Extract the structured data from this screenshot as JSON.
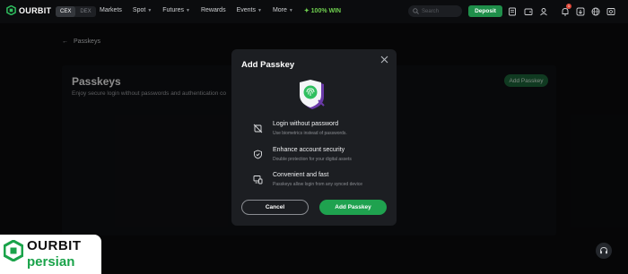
{
  "brand": {
    "name": "OURBIT"
  },
  "topnav": {
    "modes": [
      "CEX",
      "DEX"
    ],
    "links": [
      {
        "label": "Markets",
        "caret": false
      },
      {
        "label": "Spot",
        "caret": true
      },
      {
        "label": "Futures",
        "caret": true
      },
      {
        "label": "Rewards",
        "caret": false
      },
      {
        "label": "Events",
        "caret": true
      },
      {
        "label": "More",
        "caret": true
      }
    ],
    "promo": "100% WIN",
    "search_placeholder": "Search",
    "deposit_label": "Deposit",
    "notification_count": "1"
  },
  "page": {
    "back_label": "Passkeys",
    "title": "Passkeys",
    "subtitle": "Enjoy secure login without passwords and authentication co",
    "add_button_label": "Add Passkey"
  },
  "modal": {
    "title": "Add Passkey",
    "features": [
      {
        "icon": "no-password-icon",
        "title": "Login without password",
        "description": "Use biometrics instead of passwords."
      },
      {
        "icon": "shield-check-icon",
        "title": "Enhance account security",
        "description": "Double protection for your digital assets"
      },
      {
        "icon": "devices-icon",
        "title": "Convenient and fast",
        "description": "Passkeys allow login from any synced device"
      }
    ],
    "cancel_label": "Cancel",
    "confirm_label": "Add Passkey"
  },
  "watermark": {
    "line1": "OURBIT",
    "line2": "persian"
  },
  "colors": {
    "accent": "#1fa24f",
    "background": "#0b0c0e",
    "modal": "#1c1e22"
  }
}
